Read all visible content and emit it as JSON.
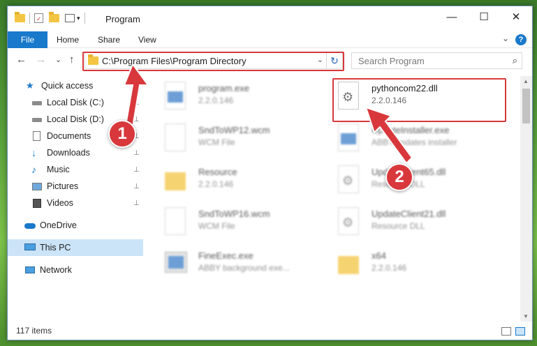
{
  "window": {
    "title": "Program",
    "minimize_glyph": "—",
    "maximize_glyph": "☐",
    "close_glyph": "✕"
  },
  "ribbon": {
    "file_label": "File",
    "tabs": [
      "Home",
      "Share",
      "View"
    ],
    "help_glyph": "?",
    "expand_glyph": "⌄"
  },
  "navigation": {
    "back_glyph": "←",
    "forward_glyph": "→",
    "recent_glyph": "⌄",
    "up_glyph": "↑",
    "address": "C:\\Program Files\\Program Directory",
    "dropdown_glyph": "⌄",
    "refresh_glyph": "↻",
    "search_placeholder": "Search Program",
    "search_glyph": "⌕"
  },
  "sidebar": {
    "items": [
      {
        "label": "Quick access",
        "icon": "star-icon",
        "pinned": false
      },
      {
        "label": "Local Disk (C:)",
        "icon": "drive-icon",
        "pinned": true
      },
      {
        "label": "Local Disk (D:)",
        "icon": "drive-icon",
        "pinned": true
      },
      {
        "label": "Documents",
        "icon": "documents-icon",
        "pinned": true
      },
      {
        "label": "Downloads",
        "icon": "download-icon",
        "pinned": true
      },
      {
        "label": "Music",
        "icon": "music-icon",
        "pinned": true
      },
      {
        "label": "Pictures",
        "icon": "pictures-icon",
        "pinned": true
      },
      {
        "label": "Videos",
        "icon": "videos-icon",
        "pinned": true
      },
      {
        "label": "OneDrive",
        "icon": "cloud-icon",
        "pinned": false
      },
      {
        "label": "This PC",
        "icon": "pc-icon",
        "pinned": false,
        "selected": true
      },
      {
        "label": "Network",
        "icon": "network-icon",
        "pinned": false
      }
    ],
    "pin_glyph": "📌"
  },
  "files": [
    {
      "name": "program.exe",
      "sub": "2.2.0.146",
      "icon": "exe-icon",
      "blurred": true
    },
    {
      "name": "pythoncom22.dll",
      "sub": "2.2.0.146",
      "icon": "dll-gear-icon",
      "blurred": false
    },
    {
      "name": "SndToWP12.wcm",
      "sub": "WCM File",
      "icon": "blank-file-icon",
      "blurred": true
    },
    {
      "name": "UpdateInstaller.exe",
      "sub": "ABBY updates installer",
      "icon": "exe-icon",
      "blurred": true
    },
    {
      "name": "Resource",
      "sub": "2.2.0.146",
      "icon": "folder-icon",
      "blurred": true
    },
    {
      "name": "UpdateClient65.dll",
      "sub": "Resource DLL",
      "icon": "dll-gear-icon",
      "blurred": true
    },
    {
      "name": "SndToWP16.wcm",
      "sub": "WCM File",
      "icon": "blank-file-icon",
      "blurred": true
    },
    {
      "name": "UpdateClient21.dll",
      "sub": "Resource DLL",
      "icon": "dll-gear-icon",
      "blurred": true
    },
    {
      "name": "FineExec.exe",
      "sub": "ABBY background exe...",
      "icon": "exe-icon",
      "blurred": true
    },
    {
      "name": "x64",
      "sub": "2.2.0.146",
      "icon": "folder-icon",
      "blurred": true
    }
  ],
  "status": {
    "item_count": "117 items"
  },
  "callouts": {
    "one": "1",
    "two": "2",
    "color": "#d8383c"
  }
}
